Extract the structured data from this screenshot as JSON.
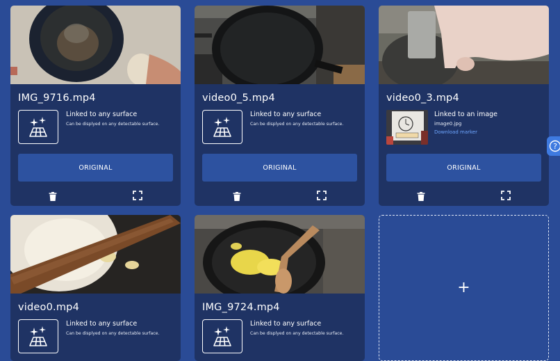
{
  "colors": {
    "background": "#2a4b96",
    "card": "#1f3364",
    "button": "#2d52a0",
    "link": "#6ea6ff"
  },
  "cards": [
    {
      "title": "IMG_9716.mp4",
      "link_title": "Linked to any surface",
      "link_desc": "Can be displyed on any detectable surface.",
      "button_label": "ORIGINAL",
      "icons": [
        "surface-icon",
        "trash-icon",
        "fullscreen-icon"
      ]
    },
    {
      "title": "video0_5.mp4",
      "link_title": "Linked to any surface",
      "link_desc": "Can be displyed on any detectable surface.",
      "button_label": "ORIGINAL",
      "icons": [
        "surface-icon",
        "trash-icon",
        "fullscreen-icon"
      ]
    },
    {
      "title": "video0_3.mp4",
      "link_title": "Linked to an image",
      "image_name": "image0.jpg",
      "download_label": "Download marker",
      "button_label": "ORIGINAL",
      "icons": [
        "marker-image",
        "trash-icon",
        "fullscreen-icon"
      ]
    },
    {
      "title": "video0.mp4",
      "link_title": "Linked to any surface",
      "link_desc": "Can be displyed on any detectable surface.",
      "icons": [
        "surface-icon"
      ]
    },
    {
      "title": "IMG_9724.mp4",
      "link_title": "Linked to any surface",
      "link_desc": "Can be displyed on any detectable surface.",
      "icons": [
        "surface-icon"
      ]
    }
  ],
  "add_card": {
    "label": "+",
    "icon": "plus-icon"
  },
  "help": {
    "label": "?",
    "icon": "help-icon"
  }
}
